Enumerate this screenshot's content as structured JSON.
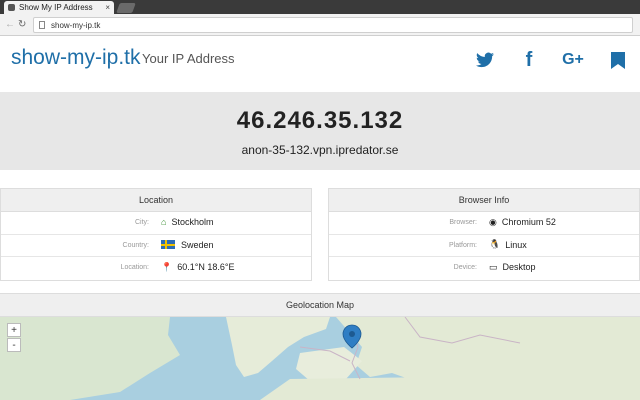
{
  "browser": {
    "tab_title": "Show My IP Address",
    "url": "show-my-ip.tk"
  },
  "header": {
    "brand": "show-my-ip.tk",
    "tagline": "Your IP Address",
    "social": [
      "twitter-icon",
      "facebook-icon",
      "google-plus-icon",
      "bookmark-icon"
    ],
    "brand_color": "#1f6fa8"
  },
  "hero": {
    "ip": "46.246.35.132",
    "hostname": "anon-35-132.vpn.ipredator.se"
  },
  "location": {
    "title": "Location",
    "rows": [
      {
        "key": "City:",
        "value": "Stockholm"
      },
      {
        "key": "Country:",
        "value": "Sweden"
      },
      {
        "key": "Location:",
        "value": "60.1°N 18.6°E"
      }
    ]
  },
  "browser_info": {
    "title": "Browser Info",
    "rows": [
      {
        "key": "Browser:",
        "value": "Chromium 52"
      },
      {
        "key": "Platform:",
        "value": "Linux"
      },
      {
        "key": "Device:",
        "value": "Desktop"
      }
    ]
  },
  "map": {
    "title": "Geolocation Map",
    "zoom_in": "+",
    "zoom_out": "-"
  }
}
